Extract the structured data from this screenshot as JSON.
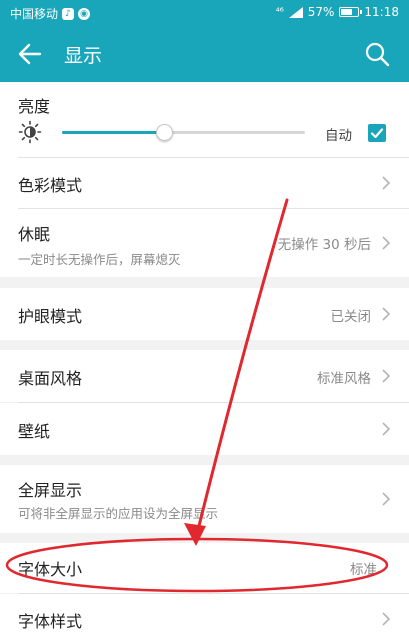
{
  "status_bar": {
    "carrier": "中国移动",
    "signal": "⁴⁶",
    "battery": "57%",
    "battery_level": 0.57,
    "time": "11:18"
  },
  "app_bar": {
    "title": "显示"
  },
  "brightness": {
    "label": "亮度",
    "level": 0.42,
    "auto_label": "自动",
    "auto_checked": true
  },
  "items": {
    "color_mode": {
      "label": "色彩模式"
    },
    "sleep": {
      "label": "休眠",
      "sub": "一定时长无操作后，屏幕熄灭",
      "value": "无操作 30 秒后"
    },
    "eye_care": {
      "label": "护眼模式",
      "value": "已关闭"
    },
    "desktop_style": {
      "label": "桌面风格",
      "value": "标准风格"
    },
    "wallpaper": {
      "label": "壁纸"
    },
    "fullscreen": {
      "label": "全屏显示",
      "sub": "可将非全屏显示的应用设为全屏显示"
    },
    "font_size": {
      "label": "字体大小",
      "value": "标准"
    },
    "font_style": {
      "label": "字体样式"
    }
  },
  "colors": {
    "accent": "#1aa6ba",
    "annotation": "#e0282e"
  }
}
